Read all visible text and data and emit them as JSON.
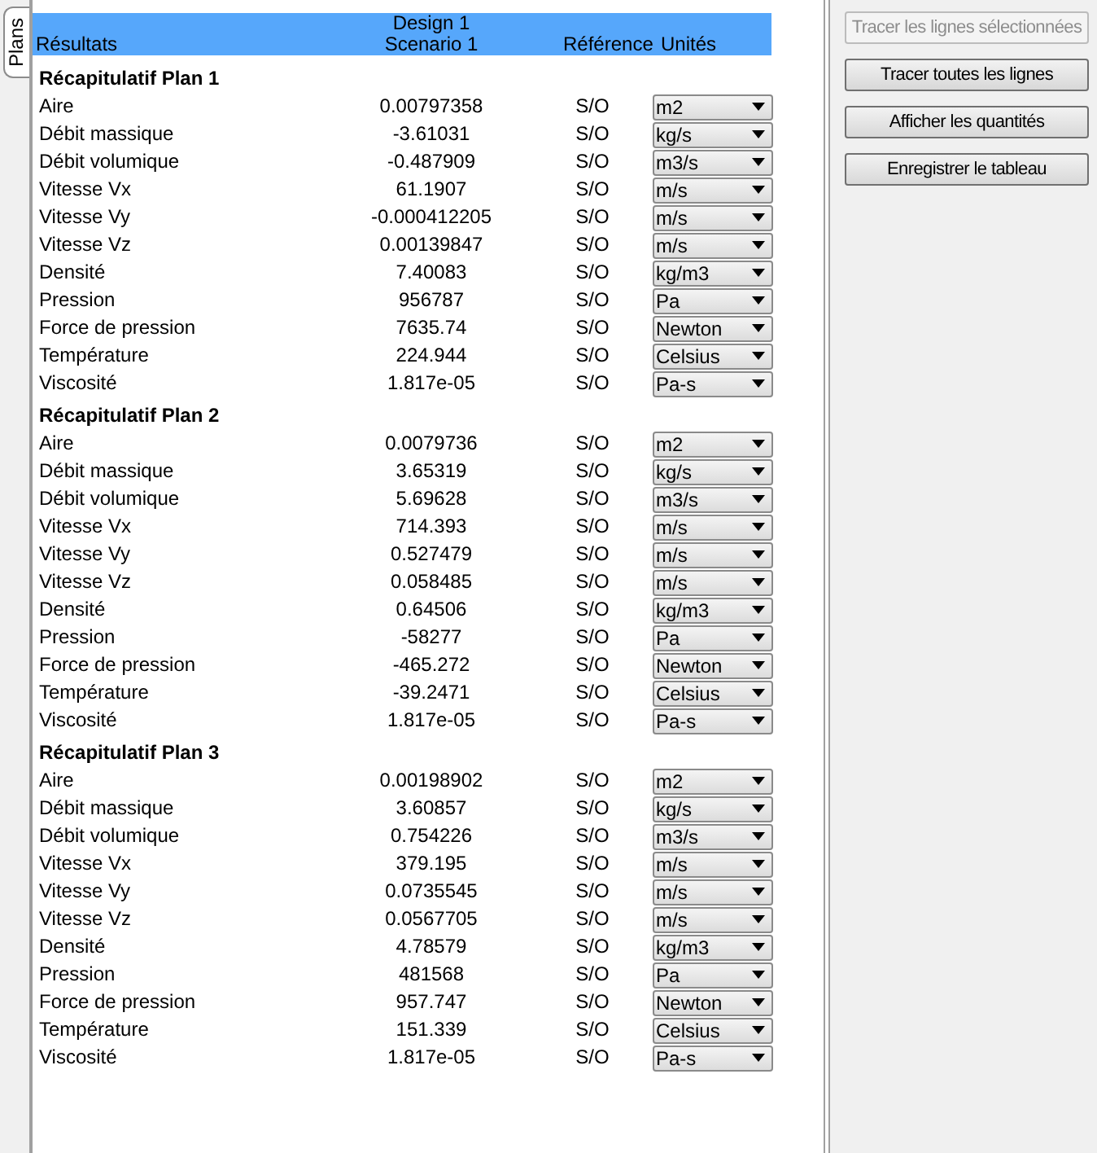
{
  "side_tab": {
    "label": "Plans",
    "selected": true
  },
  "header": {
    "col_1": "Résultats",
    "col_2_line_1": "Design 1",
    "col_2_line_2": "Scenario 1",
    "col_3": "Référence",
    "col_4": "Unités"
  },
  "sections": [
    {
      "title": "Récapitulatif Plan 1",
      "rows": [
        {
          "label": "Aire",
          "value": "0.00797358",
          "reference": "S/O",
          "unit": "m2"
        },
        {
          "label": "Débit massique",
          "value": "-3.61031",
          "reference": "S/O",
          "unit": "kg/s"
        },
        {
          "label": "Débit volumique",
          "value": "-0.487909",
          "reference": "S/O",
          "unit": "m3/s"
        },
        {
          "label": "Vitesse Vx",
          "value": "61.1907",
          "reference": "S/O",
          "unit": "m/s"
        },
        {
          "label": "Vitesse Vy",
          "value": "-0.000412205",
          "reference": "S/O",
          "unit": "m/s"
        },
        {
          "label": "Vitesse Vz",
          "value": "0.00139847",
          "reference": "S/O",
          "unit": "m/s"
        },
        {
          "label": "Densité",
          "value": "7.40083",
          "reference": "S/O",
          "unit": "kg/m3"
        },
        {
          "label": "Pression",
          "value": "956787",
          "reference": "S/O",
          "unit": "Pa"
        },
        {
          "label": "Force de pression",
          "value": "7635.74",
          "reference": "S/O",
          "unit": "Newton"
        },
        {
          "label": "Température",
          "value": "224.944",
          "reference": "S/O",
          "unit": "Celsius"
        },
        {
          "label": "Viscosité",
          "value": "1.817e-05",
          "reference": "S/O",
          "unit": "Pa-s"
        }
      ]
    },
    {
      "title": "Récapitulatif Plan 2",
      "rows": [
        {
          "label": "Aire",
          "value": "0.0079736",
          "reference": "S/O",
          "unit": "m2"
        },
        {
          "label": "Débit massique",
          "value": "3.65319",
          "reference": "S/O",
          "unit": "kg/s"
        },
        {
          "label": "Débit volumique",
          "value": "5.69628",
          "reference": "S/O",
          "unit": "m3/s"
        },
        {
          "label": "Vitesse Vx",
          "value": "714.393",
          "reference": "S/O",
          "unit": "m/s"
        },
        {
          "label": "Vitesse Vy",
          "value": "0.527479",
          "reference": "S/O",
          "unit": "m/s"
        },
        {
          "label": "Vitesse Vz",
          "value": "0.058485",
          "reference": "S/O",
          "unit": "m/s"
        },
        {
          "label": "Densité",
          "value": "0.64506",
          "reference": "S/O",
          "unit": "kg/m3"
        },
        {
          "label": "Pression",
          "value": "-58277",
          "reference": "S/O",
          "unit": "Pa"
        },
        {
          "label": "Force de pression",
          "value": "-465.272",
          "reference": "S/O",
          "unit": "Newton"
        },
        {
          "label": "Température",
          "value": "-39.2471",
          "reference": "S/O",
          "unit": "Celsius"
        },
        {
          "label": "Viscosité",
          "value": "1.817e-05",
          "reference": "S/O",
          "unit": "Pa-s"
        }
      ]
    },
    {
      "title": "Récapitulatif Plan 3",
      "rows": [
        {
          "label": "Aire",
          "value": "0.00198902",
          "reference": "S/O",
          "unit": "m2"
        },
        {
          "label": "Débit massique",
          "value": "3.60857",
          "reference": "S/O",
          "unit": "kg/s"
        },
        {
          "label": "Débit volumique",
          "value": "0.754226",
          "reference": "S/O",
          "unit": "m3/s"
        },
        {
          "label": "Vitesse Vx",
          "value": "379.195",
          "reference": "S/O",
          "unit": "m/s"
        },
        {
          "label": "Vitesse Vy",
          "value": "0.0735545",
          "reference": "S/O",
          "unit": "m/s"
        },
        {
          "label": "Vitesse Vz",
          "value": "0.0567705",
          "reference": "S/O",
          "unit": "m/s"
        },
        {
          "label": "Densité",
          "value": "4.78579",
          "reference": "S/O",
          "unit": "kg/m3"
        },
        {
          "label": "Pression",
          "value": "481568",
          "reference": "S/O",
          "unit": "Pa"
        },
        {
          "label": "Force de pression",
          "value": "957.747",
          "reference": "S/O",
          "unit": "Newton"
        },
        {
          "label": "Température",
          "value": "151.339",
          "reference": "S/O",
          "unit": "Celsius"
        },
        {
          "label": "Viscosité",
          "value": "1.817e-05",
          "reference": "S/O",
          "unit": "Pa-s"
        }
      ]
    }
  ],
  "buttons": [
    {
      "label": "Tracer les lignes sélectionnées",
      "disabled": true
    },
    {
      "label": "Tracer toutes les lignes",
      "disabled": false
    },
    {
      "label": "Afficher les quantités",
      "disabled": false
    },
    {
      "label": "Enregistrer le tableau",
      "disabled": false
    }
  ]
}
